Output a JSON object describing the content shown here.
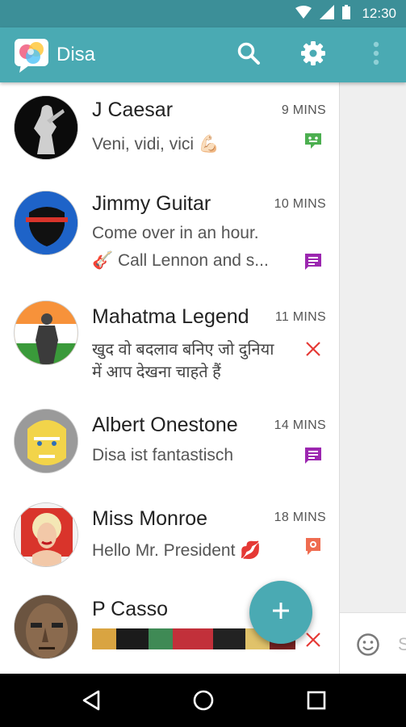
{
  "status": {
    "time": "12:30"
  },
  "app": {
    "title": "Disa",
    "accent": "#4aaab3",
    "status_bar_color": "#3c8f98"
  },
  "actions": [
    "search-icon",
    "gear-icon",
    "more-vert-icon"
  ],
  "conversations": [
    {
      "name": "J Caesar",
      "time": "9 MINS",
      "line1": "Veni, vidi, vici 💪🏻",
      "line2": "",
      "service": "hangouts",
      "service_color": "#4caf50"
    },
    {
      "name": "Jimmy Guitar",
      "time": "10 MINS",
      "line1": "Come over in an hour.",
      "line2": "🎸 Call Lennon and s...",
      "service": "sms",
      "service_color": "#9c27b0"
    },
    {
      "name": "Mahatma Legend",
      "time": "11 MINS",
      "line1": "खुद वो बदलाव बनिए जो दुनिया",
      "line2": "में आप देखना चाहते हैं",
      "service": "failed",
      "service_color": "#e53935"
    },
    {
      "name": "Albert Onestone",
      "time": "14 MINS",
      "line1": "Disa ist fantastisch",
      "line2": "",
      "service": "sms",
      "service_color": "#9c27b0"
    },
    {
      "name": "Miss Monroe",
      "time": "18 MINS",
      "line1": "Hello Mr. President 💋",
      "line2": "",
      "service": "message",
      "service_color": "#ef6c50"
    },
    {
      "name": "P Casso",
      "time": "",
      "line1": "",
      "line2": "",
      "service": "failed",
      "service_color": "#e53935"
    }
  ],
  "composer": {
    "hint": "S"
  },
  "fab": {
    "label": "+"
  }
}
